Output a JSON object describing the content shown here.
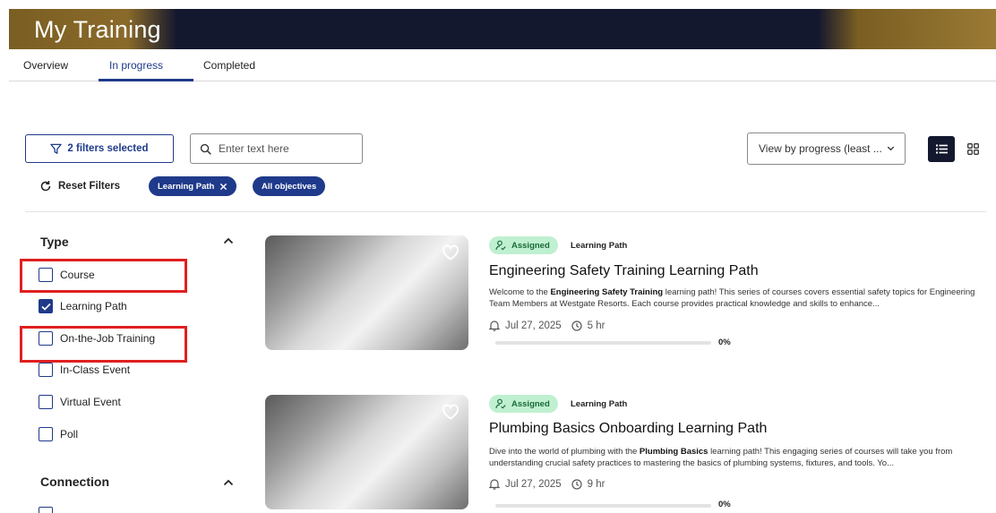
{
  "header": {
    "title": "My Training"
  },
  "tabs": [
    {
      "label": "Overview",
      "active": false
    },
    {
      "label": "In progress",
      "active": true
    },
    {
      "label": "Completed",
      "active": false
    }
  ],
  "toolbar": {
    "filters_label": "2 filters selected",
    "search_placeholder": "Enter text here",
    "search_value": "",
    "sort_value": "View by progress (least ...",
    "view_modes": [
      "list-view",
      "grid-view"
    ],
    "active_view": "list-view",
    "reset_label": "Reset Filters",
    "chips": [
      "Learning Path",
      "All objectives"
    ]
  },
  "sidebar": {
    "type_title": "Type",
    "type_options": [
      {
        "label": "Course",
        "checked": false
      },
      {
        "label": "Learning Path",
        "checked": true
      },
      {
        "label": "On-the-Job Training",
        "checked": false
      },
      {
        "label": "In-Class Event",
        "checked": false
      },
      {
        "label": "Virtual Event",
        "checked": false
      },
      {
        "label": "Poll",
        "checked": false
      }
    ],
    "connection_title": "Connection"
  },
  "cards": [
    {
      "status": "Assigned",
      "type": "Learning Path",
      "title": "Engineering Safety Training Learning Path",
      "desc_before": "Welcome to the ",
      "desc_bold": "Engineering Safety Training",
      "desc_after": " learning path! This series of courses covers essential safety topics for Engineering Team Members at Westgate Resorts. Each course provides practical knowledge and skills to enhance...",
      "date": "Jul 27, 2025",
      "duration": "5 hr",
      "progress": 0,
      "progress_label": "0%"
    },
    {
      "status": "Assigned",
      "type": "Learning Path",
      "title": "Plumbing Basics Onboarding Learning Path",
      "desc_before": "Dive into the world of plumbing with the ",
      "desc_bold": "Plumbing Basics",
      "desc_after": " learning path! This engaging series of courses will take you from understanding crucial safety practices to mastering the basics of plumbing systems, fixtures, and tools. Yo...",
      "date": "Jul 27, 2025",
      "duration": "9 hr",
      "progress": 0,
      "progress_label": "0%"
    }
  ],
  "colors": {
    "accent": "#1f3a8a",
    "banner_dark": "#14182e",
    "banner_gold": "#8a6a2a",
    "assigned_bg": "#bff0d0",
    "highlight": "#e02020"
  }
}
